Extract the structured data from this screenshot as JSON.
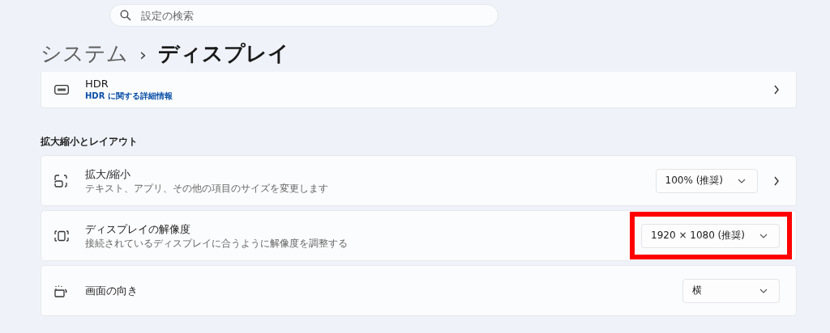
{
  "search": {
    "placeholder": "設定の検索"
  },
  "breadcrumb": {
    "parent": "システム",
    "separator": "›",
    "current": "ディスプレイ"
  },
  "hdr_card": {
    "title": "HDR",
    "link": "HDR に関する詳細情報",
    "navigable": true
  },
  "section_title": "拡大縮小とレイアウト",
  "settings": [
    {
      "title": "拡大/縮小",
      "subtitle": "テキスト、アプリ、その他の項目のサイズを変更します",
      "dropdown": "100% (推奨)",
      "navigable": true,
      "highlighted": false
    },
    {
      "title": "ディスプレイの解像度",
      "subtitle": "接続されているディスプレイに合うように解像度を調整する",
      "dropdown": "1920 × 1080 (推奨)",
      "navigable": false,
      "highlighted": true
    },
    {
      "title": "画面の向き",
      "dropdown": "横",
      "navigable": false,
      "highlighted": false
    }
  ]
}
